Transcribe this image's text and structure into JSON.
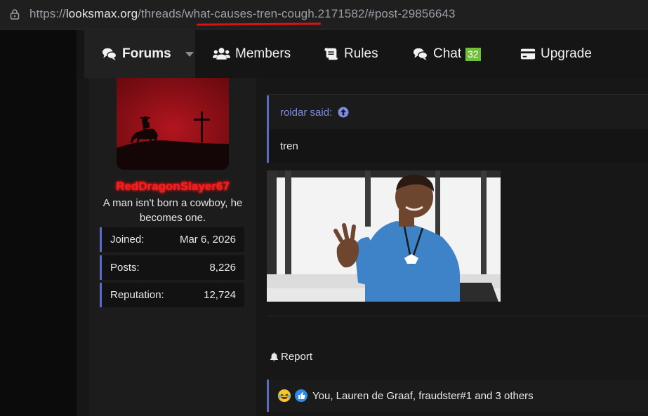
{
  "browser": {
    "url_scheme": "https://",
    "url_host": "looksmax.org",
    "url_path_prefix": "/threads/",
    "url_highlight": "what-causes-tren-cough",
    "url_rest": ".2171582/#post-29856643"
  },
  "nav": {
    "items": [
      {
        "label": "Forums",
        "icon": "comments-icon"
      },
      {
        "label": "Members",
        "icon": "users-icon"
      },
      {
        "label": "Rules",
        "icon": "scroll-icon"
      },
      {
        "label": "Chat",
        "icon": "chat-icon",
        "badge": "32"
      },
      {
        "label": "Upgrade",
        "icon": "card-icon"
      }
    ]
  },
  "user": {
    "name": "RedDragonSlayer67",
    "title": "A man isn't born a cowboy, he becomes one.",
    "stats": [
      {
        "label": "Joined:",
        "value": "Mar 6, 2026"
      },
      {
        "label": "Posts:",
        "value": "8,226"
      },
      {
        "label": "Reputation:",
        "value": "12,724"
      }
    ]
  },
  "post": {
    "quote_author": "roidar said:",
    "quote_text": "tren",
    "report_label": "Report",
    "reactions_text": "You, Lauren de Graaf, fraudster#1 and 3 others"
  },
  "colors": {
    "accent": "#5a6bc9",
    "username": "#ff1c1c",
    "badge": "#6fbf3a",
    "avatar_bg": "#8e1118"
  }
}
